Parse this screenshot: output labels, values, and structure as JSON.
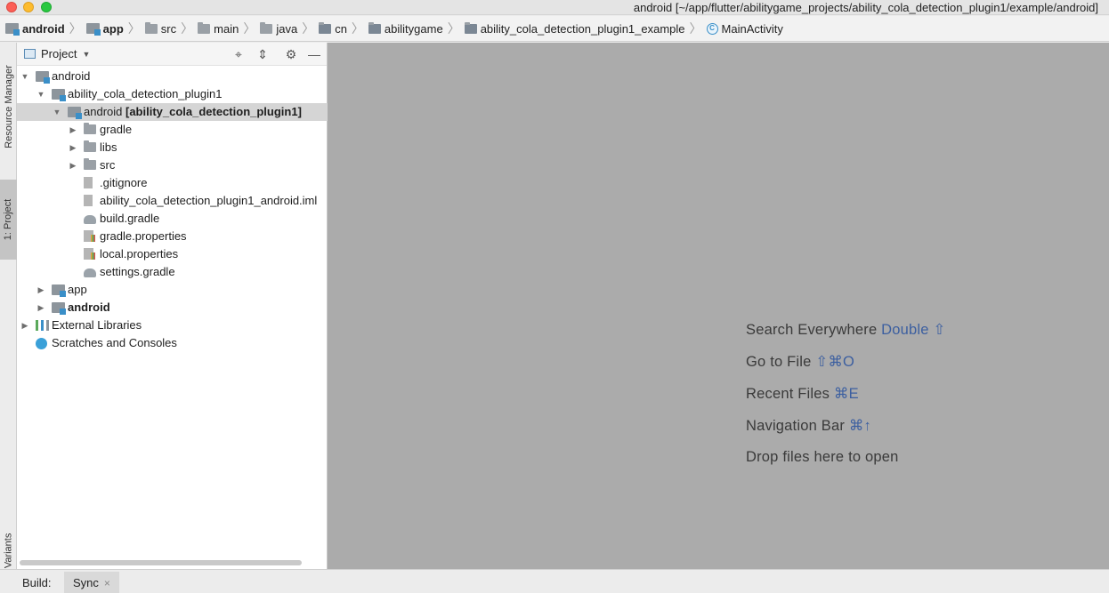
{
  "window": {
    "title": "android [~/app/flutter/abilitygame_projects/ability_cola_detection_plugin1/example/android]"
  },
  "breadcrumb": [
    {
      "label": "android",
      "icon": "module-icon",
      "bold": true
    },
    {
      "label": "app",
      "icon": "module-icon",
      "bold": true
    },
    {
      "label": "src",
      "icon": "folder-icon",
      "bold": false
    },
    {
      "label": "main",
      "icon": "folder-icon",
      "bold": false
    },
    {
      "label": "java",
      "icon": "folder-icon",
      "bold": false
    },
    {
      "label": "cn",
      "icon": "package-icon",
      "bold": false
    },
    {
      "label": "abilitygame",
      "icon": "package-icon",
      "bold": false
    },
    {
      "label": "ability_cola_detection_plugin1_example",
      "icon": "package-icon",
      "bold": false
    },
    {
      "label": "MainActivity",
      "icon": "class-icon",
      "bold": false
    }
  ],
  "leftstrip": {
    "resource_manager": "Resource Manager",
    "project": "1: Project",
    "build_variants": "d Variants"
  },
  "panel": {
    "title": "Project",
    "buttons": {
      "locate": "⌖",
      "collapse": "⇕",
      "settings": "⚙",
      "hide": "—"
    }
  },
  "tree": [
    {
      "label": "android",
      "bold_suffix": "",
      "level": 0,
      "arrow": "▼",
      "icon": "module-icon",
      "selected": false
    },
    {
      "label": "ability_cola_detection_plugin1",
      "bold_suffix": "",
      "level": 1,
      "arrow": "▼",
      "icon": "module-icon",
      "selected": false
    },
    {
      "label": "android ",
      "bold_suffix": "[ability_cola_detection_plugin1]",
      "level": 2,
      "arrow": "▼",
      "icon": "module-icon",
      "selected": true
    },
    {
      "label": "gradle",
      "bold_suffix": "",
      "level": 3,
      "arrow": "▶",
      "icon": "folder-icon",
      "selected": false
    },
    {
      "label": "libs",
      "bold_suffix": "",
      "level": 3,
      "arrow": "▶",
      "icon": "folder-icon",
      "selected": false
    },
    {
      "label": "src",
      "bold_suffix": "",
      "level": 3,
      "arrow": "▶",
      "icon": "folder-icon",
      "selected": false
    },
    {
      "label": ".gitignore",
      "bold_suffix": "",
      "level": 3,
      "arrow": "",
      "icon": "gitignore-file-icon",
      "selected": false
    },
    {
      "label": "ability_cola_detection_plugin1_android.iml",
      "bold_suffix": "",
      "level": 3,
      "arrow": "",
      "icon": "iml-file-icon",
      "selected": false
    },
    {
      "label": "build.gradle",
      "bold_suffix": "",
      "level": 3,
      "arrow": "",
      "icon": "gradle-icon",
      "selected": false
    },
    {
      "label": "gradle.properties",
      "bold_suffix": "",
      "level": 3,
      "arrow": "",
      "icon": "properties-icon",
      "selected": false
    },
    {
      "label": "local.properties",
      "bold_suffix": "",
      "level": 3,
      "arrow": "",
      "icon": "properties-icon",
      "selected": false
    },
    {
      "label": "settings.gradle",
      "bold_suffix": "",
      "level": 3,
      "arrow": "",
      "icon": "gradle-icon",
      "selected": false
    },
    {
      "label": "app",
      "bold_suffix": "",
      "level": 1,
      "arrow": "▶",
      "icon": "module-icon",
      "selected": false
    },
    {
      "label": "",
      "bold_suffix": "android",
      "level": 1,
      "arrow": "▶",
      "icon": "module-icon",
      "selected": false
    },
    {
      "label": "External Libraries",
      "bold_suffix": "",
      "level": 0,
      "arrow": "▶",
      "icon": "libraries-icon",
      "selected": false
    },
    {
      "label": "Scratches and Consoles",
      "bold_suffix": "",
      "level": 0,
      "arrow": "",
      "icon": "scratches-icon",
      "selected": false
    }
  ],
  "editor_hints": [
    {
      "text": "Search Everywhere ",
      "shortcut": "Double ⇧"
    },
    {
      "text": "Go to File ",
      "shortcut": "⇧⌘O"
    },
    {
      "text": "Recent Files ",
      "shortcut": "⌘E"
    },
    {
      "text": "Navigation Bar ",
      "shortcut": "⌘↑"
    },
    {
      "text": "Drop files here to open",
      "shortcut": ""
    }
  ],
  "bottombar": {
    "build_label": "Build:",
    "sync_tab": "Sync",
    "close": "×"
  }
}
